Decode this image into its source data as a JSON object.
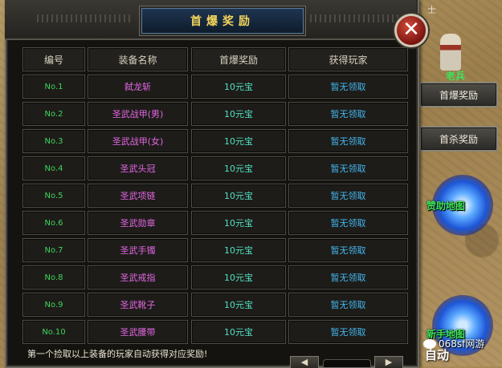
{
  "dialog": {
    "title": "首爆奖励",
    "close_label": "✕",
    "footer_note": "第一个捡取以上装备的玩家自动获得对应奖励!",
    "pager_prev": "◀",
    "pager_next": "▶"
  },
  "table": {
    "headers": [
      "编号",
      "装备名称",
      "首爆奖励",
      "获得玩家"
    ],
    "rows": [
      {
        "no": "No.1",
        "item": "弑龙斩",
        "reward": "10元宝",
        "player": "暂无领取"
      },
      {
        "no": "No.2",
        "item": "圣武战甲(男)",
        "reward": "10元宝",
        "player": "暂无领取"
      },
      {
        "no": "No.3",
        "item": "圣武战甲(女)",
        "reward": "10元宝",
        "player": "暂无领取"
      },
      {
        "no": "No.4",
        "item": "圣武头冠",
        "reward": "10元宝",
        "player": "暂无领取"
      },
      {
        "no": "No.5",
        "item": "圣武项链",
        "reward": "10元宝",
        "player": "暂无领取"
      },
      {
        "no": "No.6",
        "item": "圣武勋章",
        "reward": "10元宝",
        "player": "暂无领取"
      },
      {
        "no": "No.7",
        "item": "圣武手镯",
        "reward": "10元宝",
        "player": "暂无领取"
      },
      {
        "no": "No.8",
        "item": "圣武戒指",
        "reward": "10元宝",
        "player": "暂无领取"
      },
      {
        "no": "No.9",
        "item": "圣武靴子",
        "reward": "10元宝",
        "player": "暂无领取"
      },
      {
        "no": "No.10",
        "item": "圣武腰带",
        "reward": "10元宝",
        "player": "暂无领取"
      }
    ]
  },
  "side": {
    "first_drop_button": "首爆奖励",
    "first_kill_button": "首杀奖励",
    "sponsor_map": "赞助地图",
    "newbie_map": "新手地图",
    "auto_label": "自动",
    "npc_name_top": "士",
    "npc_name_green": "老兵"
  },
  "watermark": {
    "text": "068sf网游"
  },
  "colors": {
    "item_name": "#e467e4",
    "number": "#3fd45a",
    "reward": "#53e0c0",
    "status": "#44b7ef",
    "title": "#f3d65a"
  }
}
